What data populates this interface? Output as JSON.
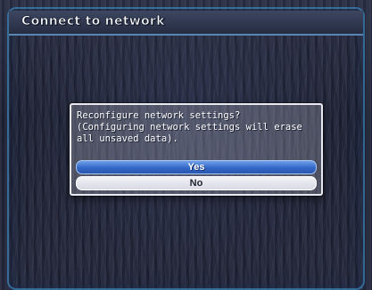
{
  "window": {
    "title": "Connect to network"
  },
  "dialog": {
    "message_lines": [
      "Reconfigure network settings?",
      "(Configuring network settings will erase",
      "all unsaved data)."
    ],
    "yes_label": "Yes",
    "no_label": "No",
    "selected_option": "Yes"
  },
  "colors": {
    "selected_button": "#3468c8",
    "unselected_button": "#d8d9e2",
    "frame_accent": "#46a0dc",
    "background": "#23283c"
  }
}
